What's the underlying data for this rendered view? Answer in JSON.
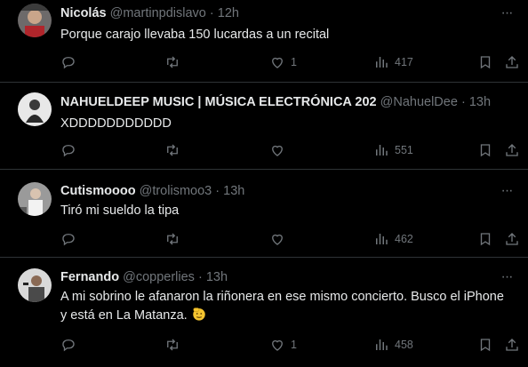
{
  "tweets": [
    {
      "name": "Nicolás",
      "handle": "@martinpdislavo",
      "separator": "·",
      "time": "12h",
      "text": "Porque carajo llevaba 150 lucardas a un recital",
      "likes": "1",
      "views": "417"
    },
    {
      "name": "NAHUELDEEP MUSIC | MÚSICA ELECTRÓNICA 202",
      "handle": "@NahuelDee",
      "separator": "·",
      "time": "13h",
      "text": "XDDDDDDDDDDD",
      "likes": "",
      "views": "551"
    },
    {
      "name": "Cutismoooo",
      "handle": "@trolismoo3",
      "separator": "·",
      "time": "13h",
      "text": "Tiró mi sueldo la tipa",
      "likes": "",
      "views": "462"
    },
    {
      "name": "Fernando",
      "handle": "@copperlies",
      "separator": "·",
      "time": "13h",
      "text": "A mi sobrino le afanaron la riñonera en ese mismo concierto. Busco el iPhone y está en La Matanza. ",
      "likes": "1",
      "views": "458"
    }
  ],
  "more_label": "···",
  "icons": {
    "reply": "reply-icon",
    "retweet": "retweet-icon",
    "like": "heart-icon",
    "views": "views-icon",
    "bookmark": "bookmark-icon",
    "share": "share-icon",
    "emoji": "saluting-face-emoji"
  },
  "colors": {
    "background": "#000000",
    "text": "#e7e9ea",
    "muted": "#71767b",
    "divider": "#2f3336"
  }
}
